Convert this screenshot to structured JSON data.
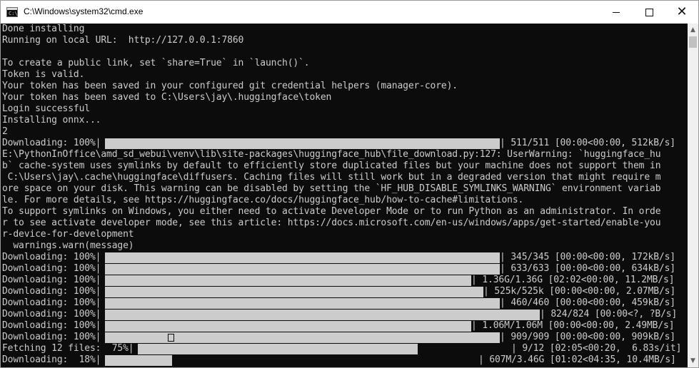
{
  "window": {
    "title": "C:\\Windows\\system32\\cmd.exe",
    "icon": "cmd-prompt-icon",
    "controls": {
      "minimize_icon": "minimize-icon",
      "maximize_icon": "maximize-icon",
      "close_icon": "close-icon"
    }
  },
  "console": {
    "lines": [
      "Done installing",
      "Running on local URL:  http://127.0.0.1:7860",
      "",
      "To create a public link, set `share=True` in `launch()`.",
      "Token is valid.",
      "Your token has been saved in your configured git credential helpers (manager-core).",
      "Your token has been saved to C:\\Users\\jay\\.huggingface\\token",
      "Login successful",
      "Installing onnx...",
      "2",
      "",
      "E:\\PythonInOffice\\amd_sd_webui\\venv\\lib\\site-packages\\huggingface_hub\\file_download.py:127: UserWarning: `huggingface_hu",
      "b` cache-system uses symlinks by default to efficiently store duplicated files but your machine does not support them in",
      " C:\\Users\\jay\\.cache\\huggingface\\diffusers. Caching files will still work but in a degraded version that might require m",
      "ore space on your disk. This warning can be disabled by setting the `HF_HUB_DISABLE_SYMLINKS_WARNING` environment variab",
      "le. For more details, see https://huggingface.co/docs/huggingface_hub/how-to-cache#limitations.",
      "To support symlinks on Windows, you either need to activate Developer Mode or to run Python as an administrator. In orde",
      "r to see activate developer mode, see this article: https://docs.microsoft.com/en-us/windows/apps/get-started/enable-you",
      "r-device-for-development",
      "  warnings.warn(message)"
    ],
    "progress": [
      {
        "label": "Downloading: 100%",
        "fraction": 1.0,
        "stats": "| 511/511 [00:00<00:00, 512kB/s]"
      },
      {
        "label": "Downloading: 100%",
        "fraction": 1.0,
        "stats": "| 345/345 [00:00<00:00, 172kB/s]"
      },
      {
        "label": "Downloading: 100%",
        "fraction": 1.0,
        "stats": "| 633/633 [00:00<00:00, 634kB/s]"
      },
      {
        "label": "Downloading: 100%",
        "fraction": 1.0,
        "stats": "| 1.36G/1.36G [02:02<00:00, 11.2MB/s]"
      },
      {
        "label": "Downloading: 100%",
        "fraction": 1.0,
        "stats": "| 525k/525k [00:00<00:00, 2.07MB/s]"
      },
      {
        "label": "Downloading: 100%",
        "fraction": 1.0,
        "stats": "| 460/460 [00:00<00:00, 459kB/s]"
      },
      {
        "label": "Downloading: 100%",
        "fraction": 1.0,
        "stats": "| 824/824 [00:00<?, ?B/s]"
      },
      {
        "label": "Downloading: 100%",
        "fraction": 1.0,
        "stats": "| 1.06M/1.06M [00:00<00:00, 2.49MB/s]"
      },
      {
        "label": "Downloading: 100%",
        "fraction": 1.0,
        "stats": "| 909/909 [00:00<00:00, 909kB/s]"
      },
      {
        "label": "Fetching 12 files:  75%",
        "fraction": 0.75,
        "stats": "| 9/12 [02:05<00:20,  6.83s/it]"
      },
      {
        "label": "Downloading:  18%",
        "fraction": 0.18,
        "stats": "| 607M/3.46G [01:02<04:35, 10.4MB/s]"
      }
    ]
  },
  "scrollbar": {
    "up_icon": "scroll-up-arrow-icon",
    "down_icon": "scroll-down-arrow-icon"
  }
}
